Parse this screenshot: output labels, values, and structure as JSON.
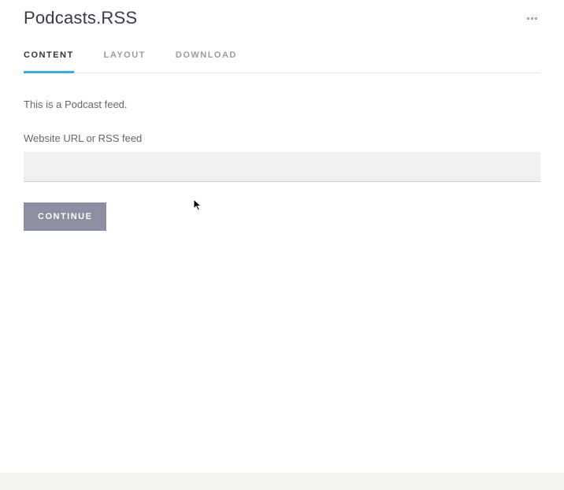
{
  "header": {
    "title": "Podcasts.RSS"
  },
  "tabs": {
    "content": "CONTENT",
    "layout": "LAYOUT",
    "download": "DOWNLOAD"
  },
  "main": {
    "description": "This is a Podcast feed.",
    "url_label": "Website URL or RSS feed",
    "url_value": "",
    "continue_label": "CONTINUE"
  }
}
